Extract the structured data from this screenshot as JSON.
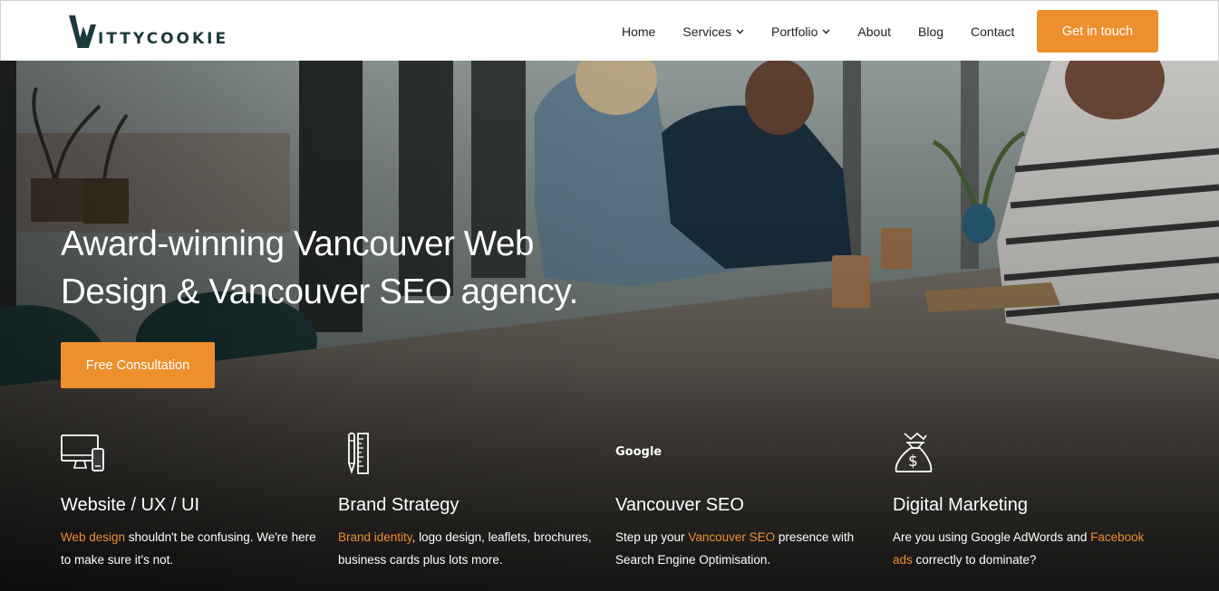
{
  "header": {
    "logo_text": "ITTYCOOKIE",
    "nav": [
      {
        "label": "Home",
        "dropdown": false
      },
      {
        "label": "Services",
        "dropdown": true
      },
      {
        "label": "Portfolio",
        "dropdown": true
      },
      {
        "label": "About",
        "dropdown": false
      },
      {
        "label": "Blog",
        "dropdown": false
      },
      {
        "label": "Contact",
        "dropdown": false
      }
    ],
    "cta_label": "Get in touch"
  },
  "hero": {
    "title_line1": "Award-winning Vancouver Web",
    "title_line2": "Design & Vancouver SEO agency.",
    "cta_label": "Free Consultation"
  },
  "features": [
    {
      "icon": "devices-icon",
      "title": "Website / UX / UI",
      "highlight": "Web design",
      "text_after": " shouldn't be confusing. We're here to make sure it's not."
    },
    {
      "icon": "pencil-ruler-icon",
      "title": "Brand Strategy",
      "highlight": "Brand identity",
      "text_after": ", logo design, leaflets, brochures, business cards plus lots more."
    },
    {
      "icon": "google-icon",
      "icon_text": "Google",
      "title": "Vancouver SEO",
      "text_before": "Step up your ",
      "highlight": "Vancouver SEO",
      "text_after": " presence with Search Engine Optimisation."
    },
    {
      "icon": "money-bag-icon",
      "title": "Digital Marketing",
      "text_before": "Are you using Google AdWords and ",
      "highlight": "Facebook ads",
      "text_after": " correctly to dominate?"
    }
  ],
  "colors": {
    "accent": "#ee8f2e",
    "logo": "#1d3a3c",
    "nav_text": "#222222",
    "hero_text": "#ffffff"
  }
}
